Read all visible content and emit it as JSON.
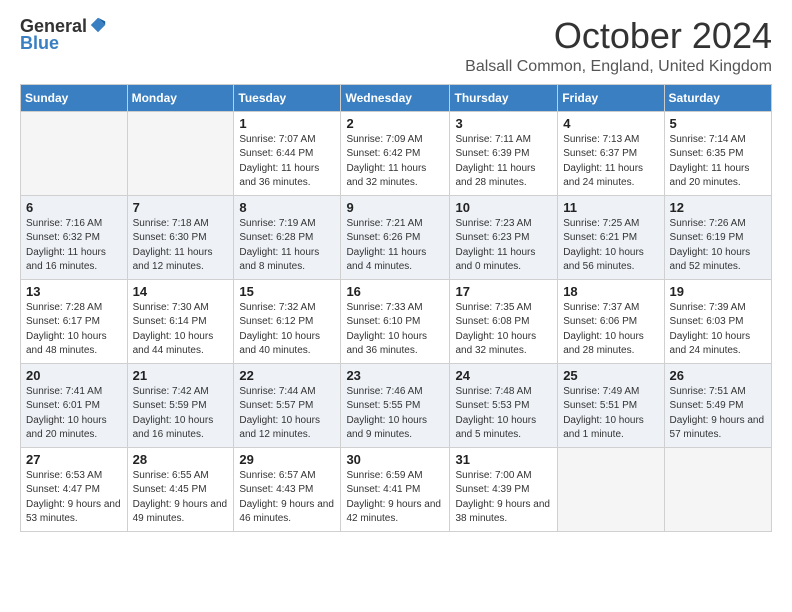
{
  "header": {
    "logo_general": "General",
    "logo_blue": "Blue",
    "month_title": "October 2024",
    "location": "Balsall Common, England, United Kingdom"
  },
  "days_of_week": [
    "Sunday",
    "Monday",
    "Tuesday",
    "Wednesday",
    "Thursday",
    "Friday",
    "Saturday"
  ],
  "weeks": [
    [
      {
        "day": "",
        "info": ""
      },
      {
        "day": "",
        "info": ""
      },
      {
        "day": "1",
        "info": "Sunrise: 7:07 AM\nSunset: 6:44 PM\nDaylight: 11 hours and 36 minutes."
      },
      {
        "day": "2",
        "info": "Sunrise: 7:09 AM\nSunset: 6:42 PM\nDaylight: 11 hours and 32 minutes."
      },
      {
        "day": "3",
        "info": "Sunrise: 7:11 AM\nSunset: 6:39 PM\nDaylight: 11 hours and 28 minutes."
      },
      {
        "day": "4",
        "info": "Sunrise: 7:13 AM\nSunset: 6:37 PM\nDaylight: 11 hours and 24 minutes."
      },
      {
        "day": "5",
        "info": "Sunrise: 7:14 AM\nSunset: 6:35 PM\nDaylight: 11 hours and 20 minutes."
      }
    ],
    [
      {
        "day": "6",
        "info": "Sunrise: 7:16 AM\nSunset: 6:32 PM\nDaylight: 11 hours and 16 minutes."
      },
      {
        "day": "7",
        "info": "Sunrise: 7:18 AM\nSunset: 6:30 PM\nDaylight: 11 hours and 12 minutes."
      },
      {
        "day": "8",
        "info": "Sunrise: 7:19 AM\nSunset: 6:28 PM\nDaylight: 11 hours and 8 minutes."
      },
      {
        "day": "9",
        "info": "Sunrise: 7:21 AM\nSunset: 6:26 PM\nDaylight: 11 hours and 4 minutes."
      },
      {
        "day": "10",
        "info": "Sunrise: 7:23 AM\nSunset: 6:23 PM\nDaylight: 11 hours and 0 minutes."
      },
      {
        "day": "11",
        "info": "Sunrise: 7:25 AM\nSunset: 6:21 PM\nDaylight: 10 hours and 56 minutes."
      },
      {
        "day": "12",
        "info": "Sunrise: 7:26 AM\nSunset: 6:19 PM\nDaylight: 10 hours and 52 minutes."
      }
    ],
    [
      {
        "day": "13",
        "info": "Sunrise: 7:28 AM\nSunset: 6:17 PM\nDaylight: 10 hours and 48 minutes."
      },
      {
        "day": "14",
        "info": "Sunrise: 7:30 AM\nSunset: 6:14 PM\nDaylight: 10 hours and 44 minutes."
      },
      {
        "day": "15",
        "info": "Sunrise: 7:32 AM\nSunset: 6:12 PM\nDaylight: 10 hours and 40 minutes."
      },
      {
        "day": "16",
        "info": "Sunrise: 7:33 AM\nSunset: 6:10 PM\nDaylight: 10 hours and 36 minutes."
      },
      {
        "day": "17",
        "info": "Sunrise: 7:35 AM\nSunset: 6:08 PM\nDaylight: 10 hours and 32 minutes."
      },
      {
        "day": "18",
        "info": "Sunrise: 7:37 AM\nSunset: 6:06 PM\nDaylight: 10 hours and 28 minutes."
      },
      {
        "day": "19",
        "info": "Sunrise: 7:39 AM\nSunset: 6:03 PM\nDaylight: 10 hours and 24 minutes."
      }
    ],
    [
      {
        "day": "20",
        "info": "Sunrise: 7:41 AM\nSunset: 6:01 PM\nDaylight: 10 hours and 20 minutes."
      },
      {
        "day": "21",
        "info": "Sunrise: 7:42 AM\nSunset: 5:59 PM\nDaylight: 10 hours and 16 minutes."
      },
      {
        "day": "22",
        "info": "Sunrise: 7:44 AM\nSunset: 5:57 PM\nDaylight: 10 hours and 12 minutes."
      },
      {
        "day": "23",
        "info": "Sunrise: 7:46 AM\nSunset: 5:55 PM\nDaylight: 10 hours and 9 minutes."
      },
      {
        "day": "24",
        "info": "Sunrise: 7:48 AM\nSunset: 5:53 PM\nDaylight: 10 hours and 5 minutes."
      },
      {
        "day": "25",
        "info": "Sunrise: 7:49 AM\nSunset: 5:51 PM\nDaylight: 10 hours and 1 minute."
      },
      {
        "day": "26",
        "info": "Sunrise: 7:51 AM\nSunset: 5:49 PM\nDaylight: 9 hours and 57 minutes."
      }
    ],
    [
      {
        "day": "27",
        "info": "Sunrise: 6:53 AM\nSunset: 4:47 PM\nDaylight: 9 hours and 53 minutes."
      },
      {
        "day": "28",
        "info": "Sunrise: 6:55 AM\nSunset: 4:45 PM\nDaylight: 9 hours and 49 minutes."
      },
      {
        "day": "29",
        "info": "Sunrise: 6:57 AM\nSunset: 4:43 PM\nDaylight: 9 hours and 46 minutes."
      },
      {
        "day": "30",
        "info": "Sunrise: 6:59 AM\nSunset: 4:41 PM\nDaylight: 9 hours and 42 minutes."
      },
      {
        "day": "31",
        "info": "Sunrise: 7:00 AM\nSunset: 4:39 PM\nDaylight: 9 hours and 38 minutes."
      },
      {
        "day": "",
        "info": ""
      },
      {
        "day": "",
        "info": ""
      }
    ]
  ]
}
